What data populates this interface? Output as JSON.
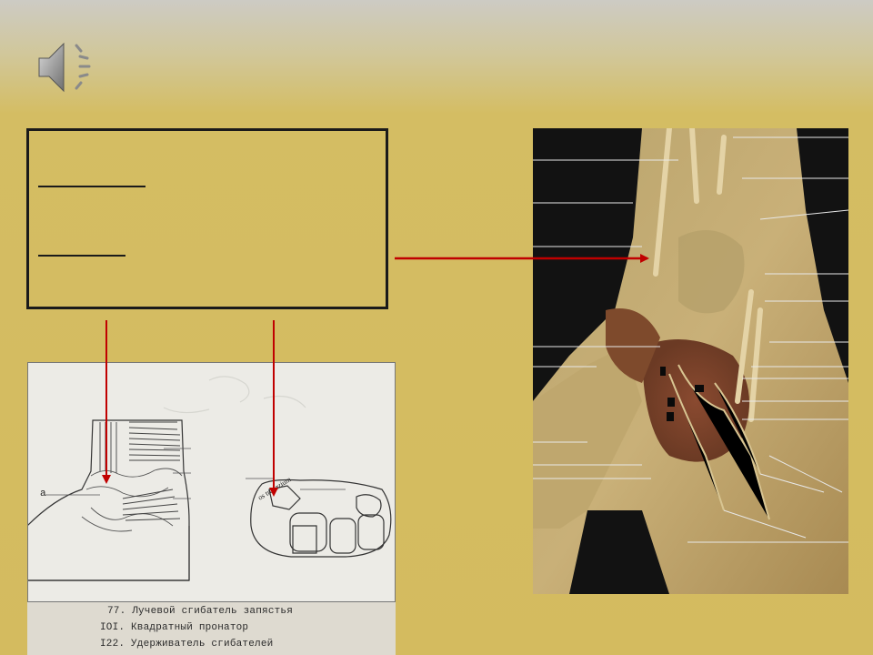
{
  "slide": {
    "background_top": "#cdcbc4",
    "background_main": "#d4bb5f",
    "arrow_color": "#c00000"
  },
  "audio": {
    "icon": "speaker-icon"
  },
  "textbox": {
    "heading_1": "",
    "heading_2": ""
  },
  "sketch": {
    "label_a": "a",
    "label_trapezium": "os trapezium",
    "captions": [
      "77. Лучевой сгибатель запястья",
      "IOI. Квадратный пронатор",
      "I22. Удерживатель сгибателей"
    ]
  },
  "photo": {
    "subject": "dissection of wrist and palm"
  }
}
